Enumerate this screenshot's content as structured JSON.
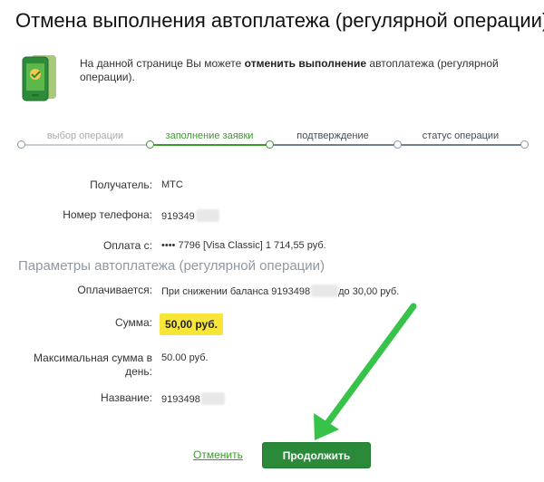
{
  "page": {
    "title": "Отмена выполнения автоплатежа (регулярной операции)"
  },
  "intro": {
    "text_before": "На данной странице Вы можете ",
    "text_bold": "отменить выполнение",
    "text_after": " автоплатежа (регулярной операции)."
  },
  "stepper": {
    "steps": [
      {
        "label": "выбор операции",
        "state": "done"
      },
      {
        "label": "заполнение заявки",
        "state": "active"
      },
      {
        "label": "подтверждение",
        "state": "upcoming"
      },
      {
        "label": "статус операции",
        "state": "upcoming"
      }
    ]
  },
  "recipient": {
    "label": "Получатель:",
    "value": "МТС"
  },
  "phone": {
    "label": "Номер телефона:",
    "value": "919349"
  },
  "payment_from": {
    "label": "Оплата с:",
    "value": "•••• 7796  [Visa Classic]  1 714,55  руб."
  },
  "params_section": {
    "title": "Параметры автоплатежа (регулярной операции)"
  },
  "paid_when": {
    "label": "Оплачивается:",
    "value_before": "При снижении баланса 9193498",
    "value_after": "до  30,00  руб."
  },
  "sum": {
    "label": "Сумма:",
    "value": "50,00  руб."
  },
  "max_daily": {
    "label": "Максимальная сумма в день:",
    "value": "50.00 руб."
  },
  "name": {
    "label": "Название:",
    "value": "9193498"
  },
  "actions": {
    "cancel_label": "Отменить",
    "continue_label": "Продолжить"
  },
  "colors": {
    "accent_green": "#3c9a2d",
    "button_green": "#2b8a3a",
    "highlight_yellow": "#f7e53a",
    "section_gray": "#8f99a2",
    "arrow_green": "#37c34a"
  }
}
